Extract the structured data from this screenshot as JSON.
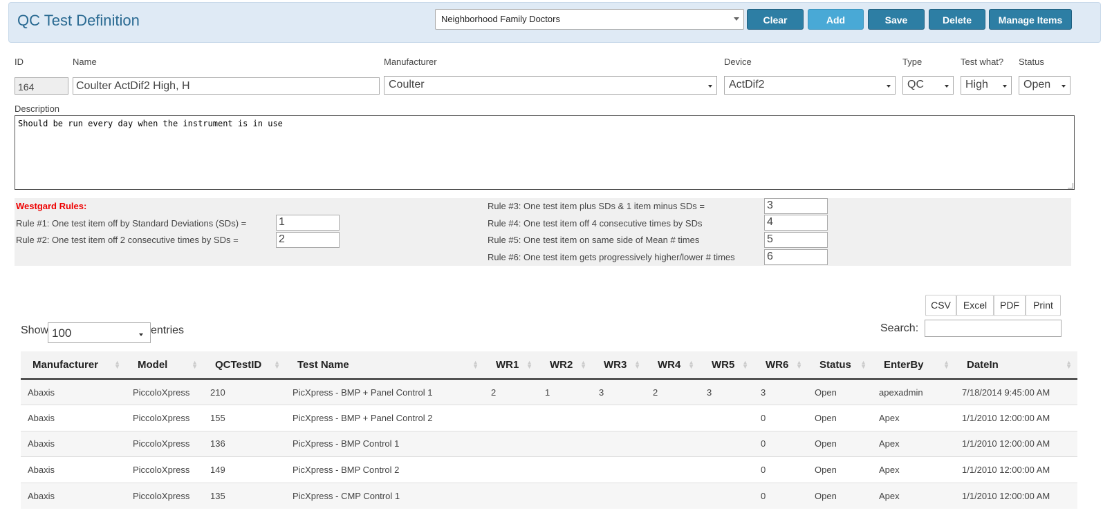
{
  "header": {
    "title": "QC Test Definition",
    "site_value": "Neighborhood Family Doctors",
    "buttons": {
      "clear": "Clear",
      "add": "Add",
      "save": "Save",
      "delete": "Delete",
      "manage_items": "Manage Items"
    }
  },
  "form": {
    "labels": {
      "id": "ID",
      "name": "Name",
      "manufacturer": "Manufacturer",
      "device": "Device",
      "type": "Type",
      "test_what": "Test what?",
      "status": "Status",
      "description": "Description"
    },
    "values": {
      "id": "164",
      "name": "Coulter ActDif2 High, H",
      "manufacturer": "Coulter",
      "device": "ActDif2",
      "type": "QC",
      "test_what": "High",
      "status": "Open"
    },
    "description": "Should be run every day when the instrument is in use"
  },
  "westgard": {
    "title": "Westgard Rules:",
    "rules": [
      {
        "label": "Rule #1: One test item off by Standard Deviations (SDs) =",
        "value": "1"
      },
      {
        "label": "Rule #2: One test item off 2 consecutive times by SDs =",
        "value": "2"
      },
      {
        "label": "Rule #3: One test item plus SDs & 1 item minus SDs =",
        "value": "3"
      },
      {
        "label": "Rule #4: One test item off 4 consecutive times by SDs",
        "value": "4"
      },
      {
        "label": "Rule #5: One test item on same side of Mean # times",
        "value": "5"
      },
      {
        "label": "Rule #6: One test item gets progressively higher/lower # times",
        "value": "6"
      }
    ]
  },
  "table_controls": {
    "export": {
      "csv": "CSV",
      "excel": "Excel",
      "pdf": "PDF",
      "print": "Print"
    },
    "show_label": "Show",
    "entries_label": "entries",
    "page_length": "100",
    "search_label": "Search:",
    "search_value": ""
  },
  "table": {
    "columns": [
      "Manufacturer",
      "Model",
      "QCTestID",
      "Test Name",
      "WR1",
      "WR2",
      "WR3",
      "WR4",
      "WR5",
      "WR6",
      "Status",
      "EnterBy",
      "DateIn"
    ],
    "rows": [
      [
        "Abaxis",
        "PiccoloXpress",
        "210",
        "PicXpress - BMP + Panel Control 1",
        "2",
        "1",
        "3",
        "2",
        "3",
        "3",
        "Open",
        "apexadmin",
        "7/18/2014 9:45:00 AM"
      ],
      [
        "Abaxis",
        "PiccoloXpress",
        "155",
        "PicXpress - BMP + Panel Control 2",
        "",
        "",
        "",
        "",
        "",
        "0",
        "Open",
        "Apex",
        "1/1/2010 12:00:00 AM"
      ],
      [
        "Abaxis",
        "PiccoloXpress",
        "136",
        "PicXpress - BMP Control 1",
        "",
        "",
        "",
        "",
        "",
        "0",
        "Open",
        "Apex",
        "1/1/2010 12:00:00 AM"
      ],
      [
        "Abaxis",
        "PiccoloXpress",
        "149",
        "PicXpress - BMP Control 2",
        "",
        "",
        "",
        "",
        "",
        "0",
        "Open",
        "Apex",
        "1/1/2010 12:00:00 AM"
      ],
      [
        "Abaxis",
        "PiccoloXpress",
        "135",
        "PicXpress - CMP Control 1",
        "",
        "",
        "",
        "",
        "",
        "0",
        "Open",
        "Apex",
        "1/1/2010 12:00:00 AM"
      ]
    ]
  }
}
